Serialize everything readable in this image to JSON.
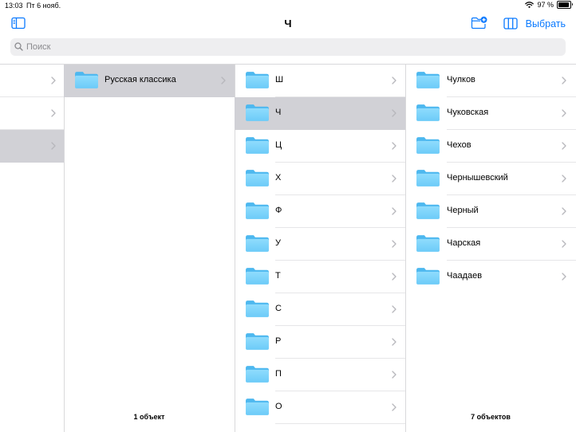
{
  "status": {
    "time": "13:03",
    "date": "Пт 6 нояб.",
    "battery": "97 %"
  },
  "nav": {
    "title": "Ч",
    "select_label": "Выбрать"
  },
  "search": {
    "placeholder": "Поиск"
  },
  "columns": {
    "col2": {
      "items": [
        {
          "label": "Русская классика"
        }
      ],
      "footer": "1 объект"
    },
    "col3": {
      "items": [
        {
          "label": "Ш"
        },
        {
          "label": "Ч"
        },
        {
          "label": "Ц"
        },
        {
          "label": "Х"
        },
        {
          "label": "Ф"
        },
        {
          "label": "У"
        },
        {
          "label": "Т"
        },
        {
          "label": "С"
        },
        {
          "label": "Р"
        },
        {
          "label": "П"
        },
        {
          "label": "О"
        }
      ]
    },
    "col4": {
      "items": [
        {
          "label": "Чулков"
        },
        {
          "label": "Чуковская"
        },
        {
          "label": "Чехов"
        },
        {
          "label": "Чернышевский"
        },
        {
          "label": "Черный"
        },
        {
          "label": "Чарская"
        },
        {
          "label": "Чаадаев"
        }
      ],
      "footer": "7 объектов"
    }
  },
  "colors": {
    "accent": "#0a7aff",
    "selected_row": "#d1d1d6",
    "folder": "#5ac8fa"
  },
  "icons": [
    "sidebar-toggle-icon",
    "new-folder-icon",
    "column-view-icon",
    "search-icon",
    "folder-icon",
    "chevron-right-icon",
    "wifi-icon",
    "battery-icon"
  ]
}
